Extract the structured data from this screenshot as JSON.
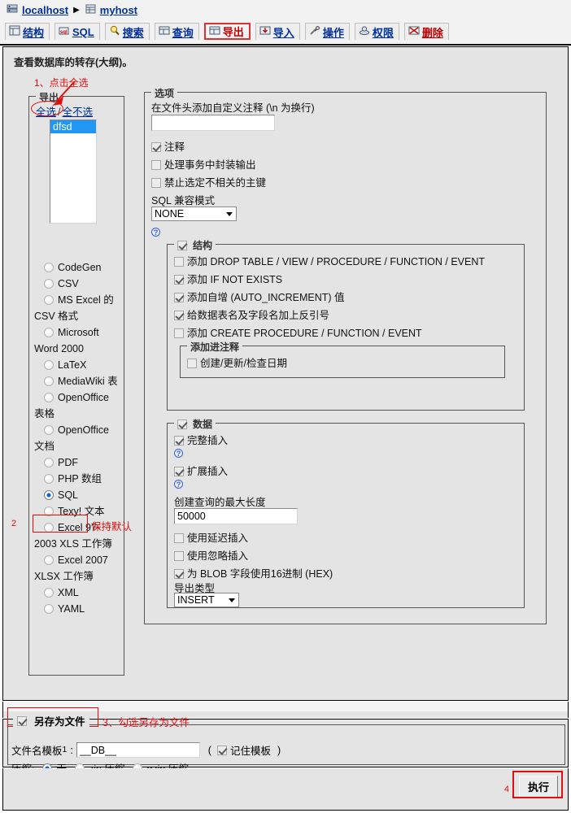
{
  "header": {
    "breadcrumb": {
      "server_icon": "server-icon",
      "server": "localhost",
      "separator": "▶",
      "db_icon": "database-icon",
      "database": "myhost"
    },
    "tabs": [
      {
        "icon": "structure-icon",
        "label": "结构",
        "active": false
      },
      {
        "icon": "sql-icon",
        "label": "SQL",
        "active": false
      },
      {
        "icon": "search-icon",
        "label": "搜索",
        "active": false
      },
      {
        "icon": "query-icon",
        "label": "查询",
        "active": false
      },
      {
        "icon": "export-icon",
        "label": "导出",
        "active": true
      },
      {
        "icon": "import-icon",
        "label": "导入",
        "active": false
      },
      {
        "icon": "operations-icon",
        "label": "操作",
        "active": false
      },
      {
        "icon": "privileges-icon",
        "label": "权限",
        "active": false
      },
      {
        "icon": "drop-icon",
        "label": "删除",
        "active": false
      }
    ]
  },
  "page_legend": "查看数据库的转存(大纲)。",
  "annotations": {
    "step1": "1、点击全选",
    "step2_number": "2",
    "step2_text": "保持默认",
    "step3": "3、勾选另存为文件",
    "step4_number": "4"
  },
  "export_panel": {
    "legend": "导出",
    "select_all": "全选",
    "slash": "/",
    "select_none": "全不选",
    "db_list": [
      {
        "name": "dfsd",
        "selected": true
      }
    ],
    "formats": [
      {
        "label": "CodeGen",
        "checked": false
      },
      {
        "label": "CSV",
        "checked": false
      },
      {
        "label": "MS Excel 的 CSV 格式",
        "checked": false
      },
      {
        "label": "Microsoft Word 2000",
        "checked": false
      },
      {
        "label": "LaTeX",
        "checked": false
      },
      {
        "label": "MediaWiki 表",
        "checked": false
      },
      {
        "label": "OpenOffice 表格",
        "checked": false
      },
      {
        "label": "OpenOffice 文档",
        "checked": false
      },
      {
        "label": "PDF",
        "checked": false
      },
      {
        "label": "PHP 数组",
        "checked": false
      },
      {
        "label": "SQL",
        "checked": true
      },
      {
        "label": "Texy! 文本",
        "checked": false
      },
      {
        "label": "Excel 97-2003 XLS 工作簿",
        "checked": false
      },
      {
        "label": "Excel 2007 XLSX 工作簿",
        "checked": false
      },
      {
        "label": "XML",
        "checked": false
      },
      {
        "label": "YAML",
        "checked": false
      }
    ]
  },
  "options_panel": {
    "legend": "选项",
    "header_comment_label": "在文件头添加自定义注释  (\\n 为换行)",
    "header_comment_value": "",
    "checkboxes": [
      {
        "label": "注释",
        "checked": true
      },
      {
        "label": "处理事务中封装输出",
        "checked": false
      },
      {
        "label": "禁止选定不相关的主键",
        "checked": false
      }
    ],
    "compat_label": "SQL 兼容模式",
    "compat_value": "NONE",
    "help_icon": "help-icon"
  },
  "structure_panel": {
    "legend": "结构",
    "legend_checked": true,
    "items": [
      {
        "label": "添加  DROP TABLE / VIEW / PROCEDURE / FUNCTION / EVENT",
        "checked": false
      },
      {
        "label": "添加  IF NOT EXISTS",
        "checked": true
      },
      {
        "label": "添加自增  (AUTO_INCREMENT) 值",
        "checked": true
      },
      {
        "label": "给数据表名及字段名加上反引号",
        "checked": true
      },
      {
        "label": "添加  CREATE PROCEDURE / FUNCTION / EVENT",
        "checked": false
      }
    ],
    "comment_box": {
      "legend": "添加进注释",
      "items": [
        {
          "label": "创建/更新/检查日期",
          "checked": false
        }
      ]
    }
  },
  "data_panel": {
    "legend": "数据",
    "legend_checked": true,
    "full_insert": {
      "label": "完整插入",
      "checked": true
    },
    "extended_insert": {
      "label": "扩展插入",
      "checked": true
    },
    "max_query_label": "创建查询的最大长度",
    "max_query_value": "50000",
    "delayed_insert": {
      "label": "使用延迟插入",
      "checked": false
    },
    "ignore_insert": {
      "label": "使用忽略插入",
      "checked": false
    },
    "hex_blob": {
      "label": "为  BLOB 字段使用16进制  (HEX)",
      "checked": true
    },
    "export_type_label": "导出类型",
    "export_type_value": "INSERT",
    "help_icon": "help-icon"
  },
  "save_file_panel": {
    "legend": "另存为文件",
    "legend_checked": true,
    "filename_label": "文件名模板",
    "filename_sup": "1",
    "filename_colon": ":",
    "filename_value": "__DB__",
    "paren_open": "(",
    "remember_label": "记住模板",
    "remember_checked": true,
    "paren_close": ")",
    "compression_label": "压缩:",
    "compression_options": [
      {
        "label": "无",
        "checked": true
      },
      {
        "label": "zip 压缩",
        "checked": false
      },
      {
        "label": "gzip 压缩",
        "checked": false
      }
    ]
  },
  "footer": {
    "go_button": "执行"
  },
  "colors": {
    "link": "#00309c",
    "annotation_red": "#e01010",
    "active_tab_text": "#c00000",
    "selection_blue": "#2196f3",
    "panel_bg": "#e4e4e4",
    "header_bg": "#f2f2f2"
  }
}
